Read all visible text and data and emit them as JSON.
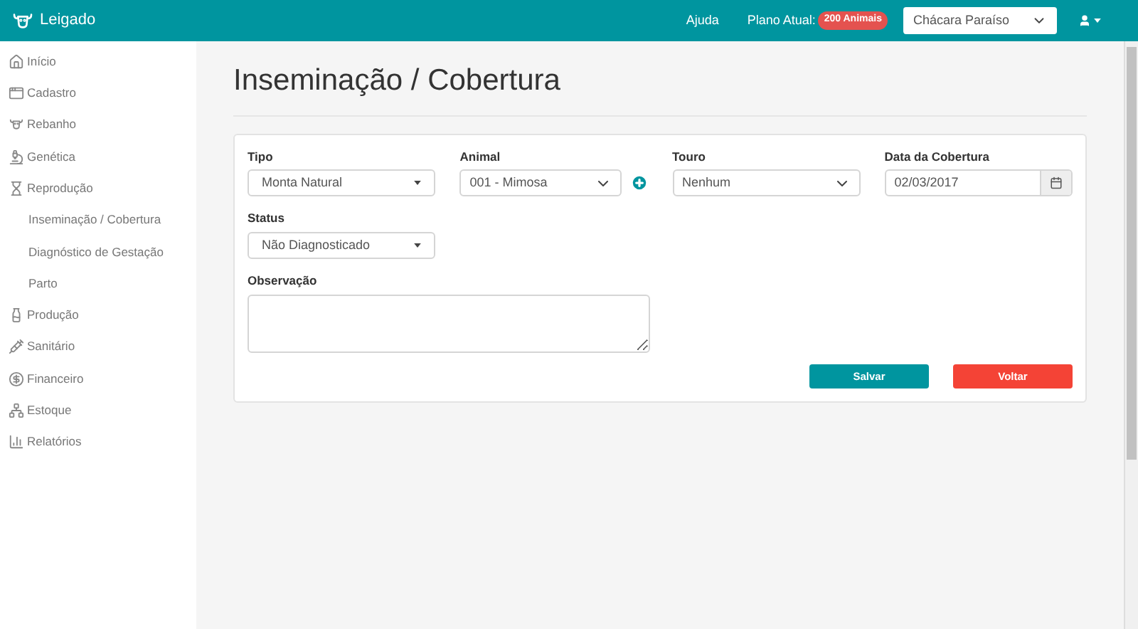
{
  "header": {
    "brand": "Leigado",
    "help": "Ajuda",
    "plan_label": "Plano Atual:",
    "plan_badge": "200 Animais",
    "farm": "Chácara Paraíso"
  },
  "sidebar": {
    "items": [
      {
        "label": "Início"
      },
      {
        "label": "Cadastro"
      },
      {
        "label": "Rebanho"
      },
      {
        "label": "Genética"
      },
      {
        "label": "Reprodução",
        "children": [
          {
            "label": "Inseminação / Cobertura"
          },
          {
            "label": "Diagnóstico de Gestação"
          },
          {
            "label": "Parto"
          }
        ]
      },
      {
        "label": "Produção"
      },
      {
        "label": "Sanitário"
      },
      {
        "label": "Financeiro"
      },
      {
        "label": "Estoque"
      },
      {
        "label": "Relatórios"
      }
    ]
  },
  "page": {
    "title": "Inseminação / Cobertura"
  },
  "form": {
    "fields": [
      {
        "kind": "select",
        "label": "Tipo",
        "value": "Monta Natural"
      },
      {
        "kind": "select-add",
        "label": "Animal",
        "value": "001 - Mimosa"
      },
      {
        "kind": "chevron-select",
        "label": "Touro",
        "value": "Nenhum"
      },
      {
        "kind": "date",
        "label": "Data da Cobertura",
        "value": "02/03/2017"
      },
      {
        "kind": "select",
        "label": "Status",
        "value": "Não Diagnosticado"
      }
    ],
    "observation": {
      "label": "Observação"
    },
    "buttons": [
      {
        "kind": "primary",
        "label": "Salvar"
      },
      {
        "kind": "danger",
        "label": "Voltar"
      }
    ]
  }
}
